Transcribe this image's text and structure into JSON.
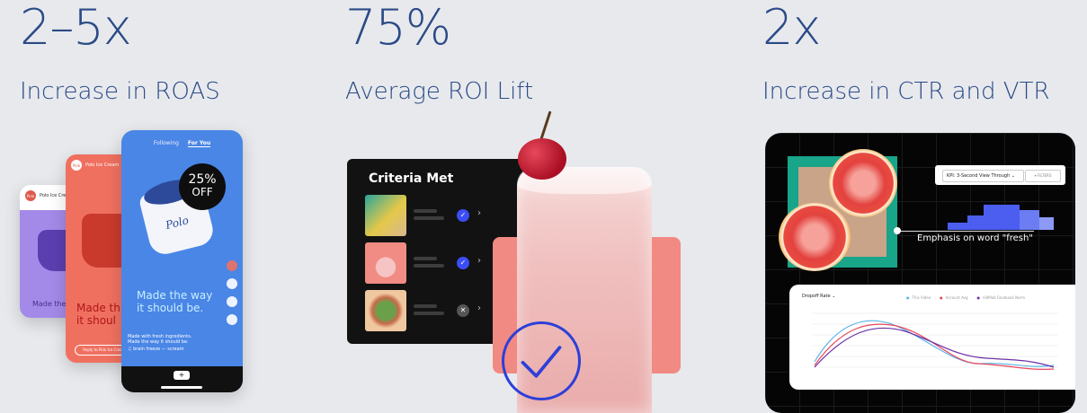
{
  "stats": [
    {
      "value": "2–5x",
      "label": "Increase in ROAS"
    },
    {
      "value": "75%",
      "label": "Average ROI Lift"
    },
    {
      "value": "2x",
      "label": "Increase in CTR and VTR"
    }
  ],
  "phone": {
    "tabs": [
      "Following",
      "For You"
    ],
    "badge_pct": "25%",
    "badge_off": "OFF",
    "tagline": "Made the way it should be.",
    "back_tagline_red": "Made th\nit shoul",
    "back_tagline_purple": "Made the",
    "brand": "Polo",
    "account": "Polo Ice Cream",
    "caption": "Made with fresh ingredients.\nMade the way it should be.",
    "sound": "♫ brain freeze — scream",
    "reply": "Reply to Polo Ice Cream"
  },
  "criteria": {
    "title": "Criteria Met",
    "rows": [
      {
        "status": "met",
        "icon": "check-icon"
      },
      {
        "status": "met",
        "icon": "check-icon"
      },
      {
        "status": "not-met",
        "icon": "x-icon"
      }
    ]
  },
  "dashboard": {
    "kpi_label": "KPI: 3-Second View Through",
    "filter_label": "FILTERS",
    "emphasis": "Emphasis on word \"fresh\"",
    "chart_title": "Dropoff Rate",
    "legend": [
      "This Video",
      "Account Avg",
      "VidMob Facebook Norm"
    ]
  },
  "colors": {
    "stat_text": "#2b4a86",
    "background": "#e7e9ed",
    "check_blue": "#2d3fd9",
    "bar_blue": "#4b5ef0"
  }
}
